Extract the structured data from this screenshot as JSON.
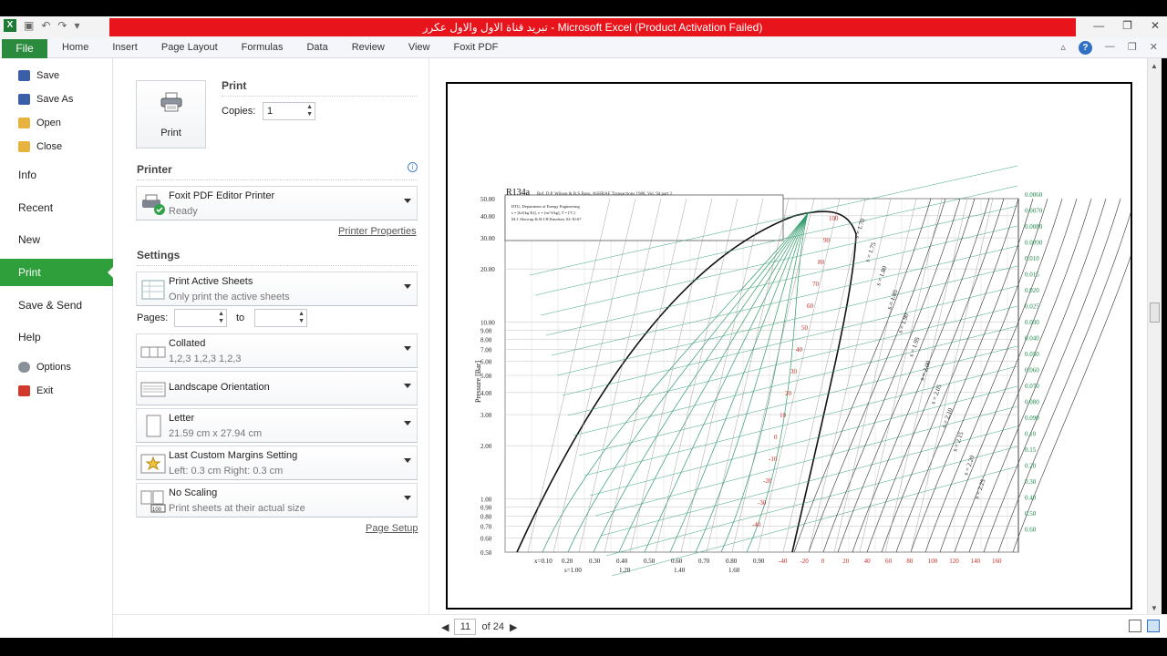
{
  "window": {
    "title": "تبريد قناة الاول والاول عكرر - Microsoft Excel (Product Activation Failed)"
  },
  "ribbon": {
    "file_tab": "File",
    "tabs": [
      "Home",
      "Insert",
      "Page Layout",
      "Formulas",
      "Data",
      "Review",
      "View",
      "Foxit PDF"
    ]
  },
  "nav": {
    "save": "Save",
    "save_as": "Save As",
    "open": "Open",
    "close": "Close",
    "info": "Info",
    "recent": "Recent",
    "new": "New",
    "print": "Print",
    "save_send": "Save & Send",
    "help": "Help",
    "options": "Options",
    "exit": "Exit"
  },
  "print": {
    "section_title": "Print",
    "button_label": "Print",
    "copies_label": "Copies:",
    "copies_value": "1"
  },
  "printer": {
    "section_title": "Printer",
    "name": "Foxit PDF Editor Printer",
    "status": "Ready",
    "properties_link": "Printer Properties"
  },
  "settings": {
    "section_title": "Settings",
    "what": {
      "title": "Print Active Sheets",
      "desc": "Only print the active sheets"
    },
    "pages_label": "Pages:",
    "pages_to": "to",
    "collate": {
      "title": "Collated",
      "desc": "1,2,3    1,2,3    1,2,3"
    },
    "orientation": {
      "title": "Landscape Orientation"
    },
    "paper": {
      "title": "Letter",
      "desc": "21.59 cm x 27.94 cm"
    },
    "margins": {
      "title": "Last Custom Margins Setting",
      "desc": "Left:  0.3 cm    Right:  0.3 cm"
    },
    "scaling": {
      "title": "No Scaling",
      "desc": "Print sheets at their actual size"
    },
    "page_setup_link": "Page Setup"
  },
  "preview": {
    "current_page": "11",
    "of_pages": "of 24",
    "chart": {
      "title": "R134a",
      "ref": "Ref. D.P. Wilson & R.S.Basu, ASHRAE Transactions 1988, Vol. 94 part 2.",
      "box_lines": [
        "DTU, Department of Energy Engineering",
        "s = [kJ/(kg K)], v = [m^3/kg], T = [ºC]",
        "M.J. Skovrup & H.J.H Knudsen. 02-10-67"
      ],
      "ylabel": "Pressure [Bar]",
      "y_ticks": [
        "50.00",
        "40.00",
        "30.00",
        "20.00",
        "10.00",
        "9.00",
        "8.00",
        "7.00",
        "6.00",
        "5.00",
        "4.00",
        "3.00",
        "2.00",
        "1.00",
        "0.90",
        "0.80",
        "0.70",
        "0.60",
        "0.50"
      ],
      "x_ticks": [
        "-40",
        "-20",
        "0",
        "20",
        "40",
        "60",
        "80",
        "100",
        "120",
        "140",
        "160"
      ],
      "quality_ticks": [
        "x=0.10",
        "0.20",
        "0.30",
        "0.40",
        "0.50",
        "0.60",
        "0.70",
        "0.80",
        "0.90"
      ],
      "s_ticks": [
        "s=1.00",
        "1.20",
        "1.40",
        "1.60"
      ],
      "right_v_ticks": [
        "0.0060",
        "0.0070",
        "0.0080",
        "0.0090",
        "0.010",
        "0.015",
        "0.020",
        "0.025",
        "0.030",
        "0.040",
        "0.050",
        "0.060",
        "0.070",
        "0.080",
        "0.090",
        "0.10",
        "0.15",
        "0.20",
        "0.30",
        "0.40",
        "0.50",
        "0.60"
      ],
      "entropy_labels": [
        "s = 1.70",
        "s = 1.75",
        "s = 1.80",
        "s = 1.85",
        "s = 1.90",
        "s = 1.95",
        "s = 2.00",
        "s = 2.05",
        "s = 2.10",
        "s = 2.15",
        "s = 2.20",
        "s = 2.25"
      ],
      "temp_labels": [
        "100",
        "90",
        "80",
        "70",
        "60",
        "50",
        "40",
        "30",
        "20",
        "10",
        "0",
        "-10",
        "-20",
        "-30",
        "-40"
      ]
    }
  }
}
